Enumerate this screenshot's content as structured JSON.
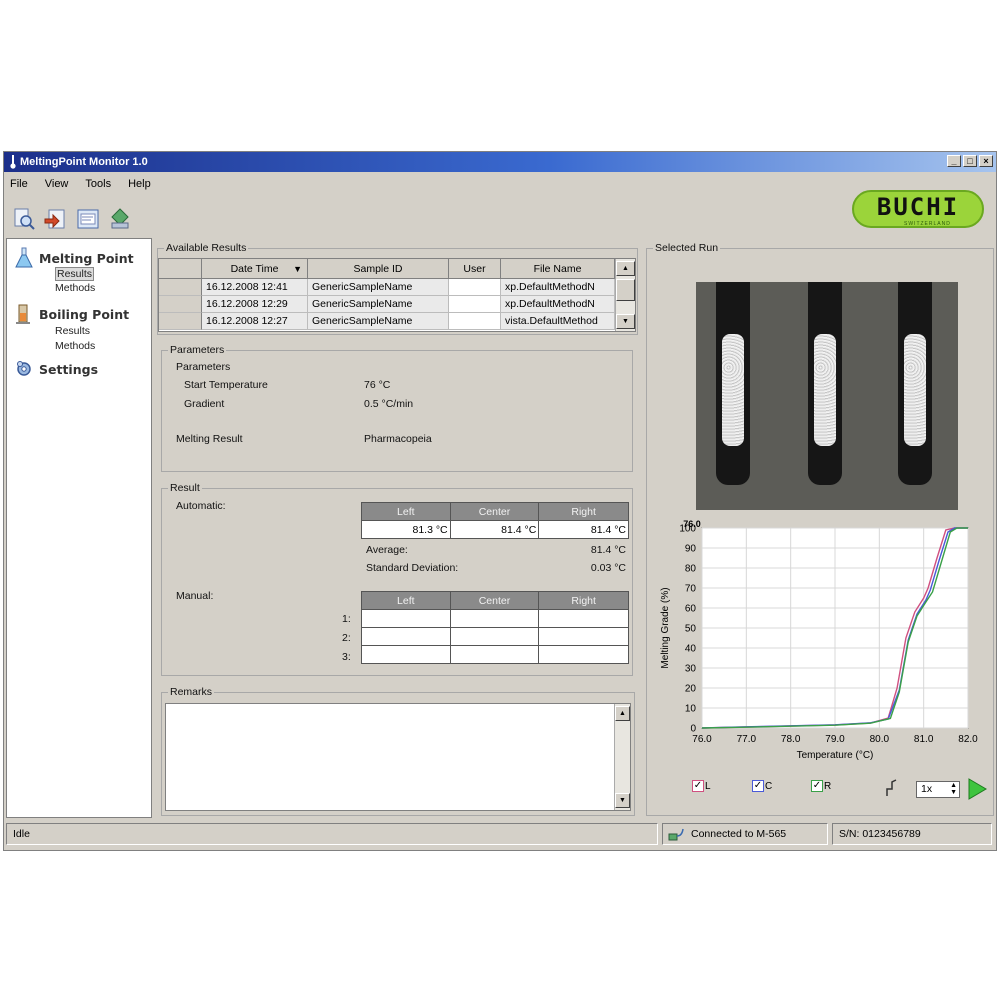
{
  "window": {
    "title": "MeltingPoint Monitor 1.0",
    "controls": [
      "_",
      "□",
      "×"
    ]
  },
  "menu": [
    "File",
    "View",
    "Tools",
    "Help"
  ],
  "brand": {
    "logo_text": "BUCHI",
    "logo_sub": "SWITZERLAND"
  },
  "nav": {
    "melting": {
      "label": "Melting Point",
      "items": [
        "Results",
        "Methods"
      ]
    },
    "boiling": {
      "label": "Boiling Point",
      "items": [
        "Results",
        "Methods"
      ]
    },
    "settings": {
      "label": "Settings"
    }
  },
  "available_results": {
    "title": "Available Results",
    "columns": [
      "Date Time",
      "Sample ID",
      "User",
      "File Name"
    ],
    "rows": [
      {
        "date": "16.12.2008 12:41",
        "sample": "GenericSampleName",
        "user": "",
        "file": "xp.DefaultMethodN"
      },
      {
        "date": "16.12.2008 12:29",
        "sample": "GenericSampleName",
        "user": "",
        "file": "xp.DefaultMethodN"
      },
      {
        "date": "16.12.2008 12:27",
        "sample": "GenericSampleName",
        "user": "",
        "file": "vista.DefaultMethod"
      }
    ]
  },
  "parameters": {
    "title": "Parameters",
    "subtitle": "Parameters",
    "start_temp_label": "Start Temperature",
    "start_temp_value": "76 °C",
    "gradient_label": "Gradient",
    "gradient_value": "0.5 °C/min",
    "melting_result_label": "Melting Result",
    "melting_result_value": "Pharmacopeia"
  },
  "result": {
    "title": "Result",
    "automatic_label": "Automatic:",
    "columns": [
      "Left",
      "Center",
      "Right"
    ],
    "automatic_values": [
      "81.3 °C",
      "81.4 °C",
      "81.4 °C"
    ],
    "average_label": "Average:",
    "average_value": "81.4 °C",
    "std_label": "Standard Deviation:",
    "std_value": "0.03 °C",
    "manual_label": "Manual:",
    "manual_rows": [
      "1:",
      "2:",
      "3:"
    ]
  },
  "remarks": {
    "title": "Remarks",
    "text": ""
  },
  "selected_run": {
    "title": "Selected Run"
  },
  "chart_data": {
    "type": "line",
    "title": "",
    "marker_label": "76.0",
    "xlabel": "Temperature (°C)",
    "ylabel": "Melting Grade (%)",
    "xlim": [
      76.0,
      82.0
    ],
    "ylim": [
      0,
      100
    ],
    "xticks": [
      "76.0",
      "77.0",
      "78.0",
      "79.0",
      "80.0",
      "81.0",
      "82.0"
    ],
    "yticks": [
      "0",
      "10",
      "20",
      "30",
      "40",
      "50",
      "60",
      "70",
      "80",
      "90",
      "100"
    ],
    "grid": true,
    "series": [
      {
        "name": "L",
        "color": "#d05080",
        "x": [
          76.0,
          77.0,
          78.0,
          79.0,
          79.8,
          80.2,
          80.4,
          80.6,
          80.8,
          81.0,
          81.1,
          81.3,
          81.5,
          81.7,
          82.0
        ],
        "y": [
          0,
          0.5,
          1,
          1.5,
          2.5,
          5,
          20,
          45,
          58,
          65,
          70,
          85,
          99,
          100,
          100
        ]
      },
      {
        "name": "C",
        "color": "#4a5ad8",
        "x": [
          76.0,
          77.0,
          78.0,
          79.0,
          79.8,
          80.2,
          80.45,
          80.65,
          80.85,
          81.05,
          81.15,
          81.35,
          81.55,
          81.7,
          82.0
        ],
        "y": [
          0,
          0.6,
          1.1,
          1.6,
          2.6,
          4.5,
          19,
          44,
          57,
          64,
          69,
          84,
          98,
          100,
          100
        ]
      },
      {
        "name": "R",
        "color": "#3aa048",
        "x": [
          76.0,
          77.0,
          78.0,
          79.0,
          79.8,
          80.25,
          80.45,
          80.65,
          80.85,
          81.05,
          81.2,
          81.4,
          81.6,
          81.75,
          82.0
        ],
        "y": [
          0,
          0.4,
          0.9,
          1.4,
          2.4,
          4.8,
          18,
          43,
          56,
          63,
          68,
          83,
          98,
          100,
          100
        ]
      }
    ]
  },
  "chart_legend": [
    "L",
    "C",
    "R"
  ],
  "playback": {
    "speed": "1x"
  },
  "status": {
    "state": "Idle",
    "connection": "Connected to M-565",
    "serial": "S/N: 0123456789"
  },
  "colors": {
    "title_start": "#1c2f8a",
    "title_end": "#a6c4ee",
    "window_bg": "#d4d0c8",
    "logo_green": "#9bd43a",
    "play_green": "#3ec43e"
  }
}
